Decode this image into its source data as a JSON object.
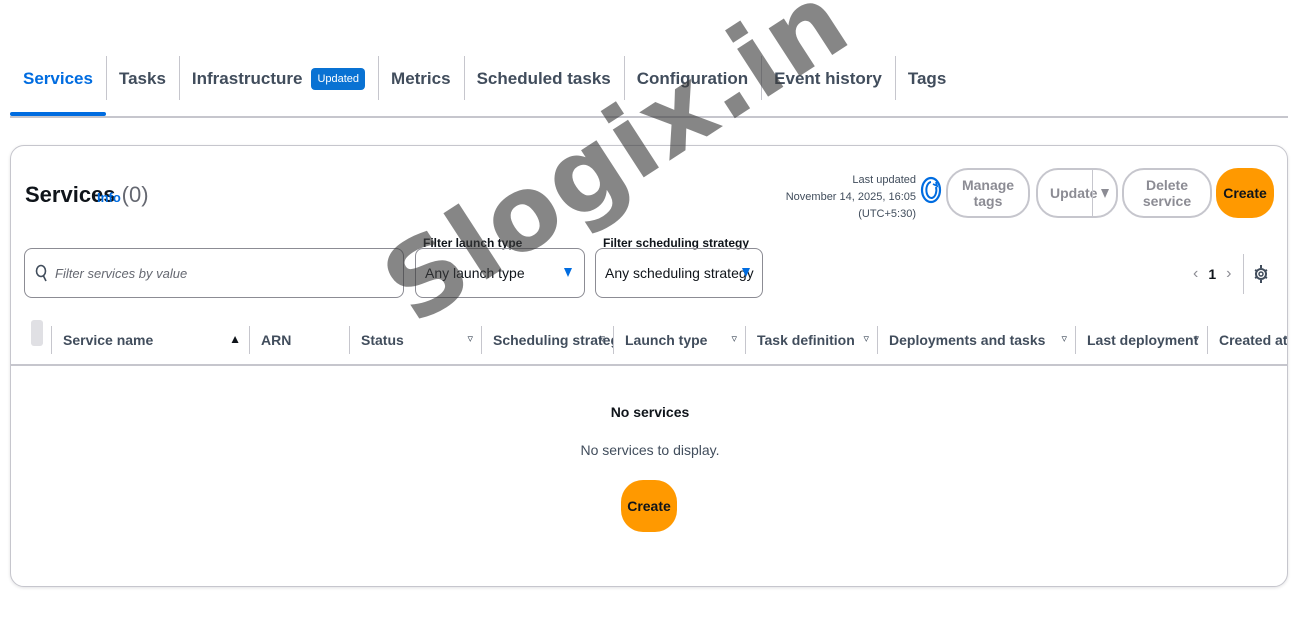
{
  "tabs": [
    {
      "label": "Services",
      "active": true
    },
    {
      "label": "Tasks"
    },
    {
      "label": "Infrastructure",
      "badge": "Updated"
    },
    {
      "label": "Metrics"
    },
    {
      "label": "Scheduled tasks"
    },
    {
      "label": "Configuration"
    },
    {
      "label": "Event history"
    },
    {
      "label": "Tags"
    }
  ],
  "panel": {
    "title": "Services",
    "count": "(0)",
    "info": "Info",
    "last_updated_label": "Last updated",
    "last_updated_value": "November 14, 2025, 16:05 (UTC+5:30)",
    "actions": {
      "manage_tags": "Manage tags",
      "update": "Update",
      "delete": "Delete service",
      "create": "Create"
    }
  },
  "filters": {
    "search_placeholder": "Filter services by value",
    "launch_type": {
      "legend": "Filter launch type",
      "value": "Any launch type"
    },
    "scheduling_strategy": {
      "legend": "Filter scheduling strategy",
      "value": "Any scheduling strategy"
    }
  },
  "pagination": {
    "current_page": "1"
  },
  "table": {
    "columns": [
      {
        "label": "Service name",
        "sort": "▲"
      },
      {
        "label": "ARN"
      },
      {
        "label": "Status",
        "sort": "▿"
      },
      {
        "label": "Scheduling strategy",
        "sort": "▿"
      },
      {
        "label": "Launch type",
        "sort": "▿"
      },
      {
        "label": "Task definition",
        "sort": "▿"
      },
      {
        "label": "Deployments and tasks",
        "sort": "▿"
      },
      {
        "label": "Last deployment",
        "sort": "▿"
      },
      {
        "label": "Created at",
        "sort": "▿"
      }
    ],
    "empty_title": "No services",
    "empty_description": "No services to display.",
    "empty_action": "Create"
  },
  "watermark": "Slogix.in",
  "colors": {
    "accent": "#006ce0",
    "primary_button": "#ff9900",
    "badge": "#0972d3"
  }
}
